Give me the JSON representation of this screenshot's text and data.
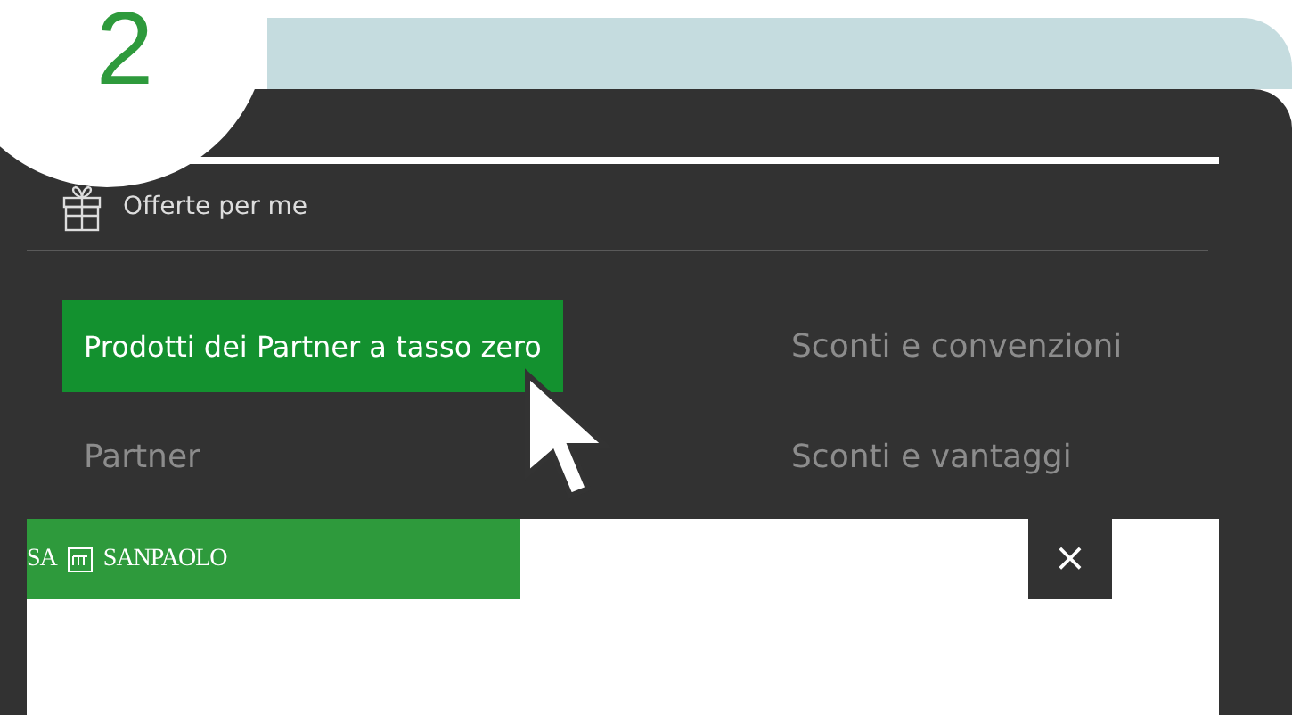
{
  "step_number": "2",
  "header": {
    "label": "Offerte per me"
  },
  "menu": [
    {
      "label": "Prodotti dei Partner a tasso zero",
      "selected": true
    },
    {
      "label": "Sconti e convenzioni",
      "selected": false
    },
    {
      "label": "Partner",
      "selected": false
    },
    {
      "label": "Sconti e vantaggi",
      "selected": false
    }
  ],
  "logo_bar": {
    "text_left": "SA",
    "text_right": "SANPAOLO"
  },
  "close_button": {
    "label": "×"
  }
}
